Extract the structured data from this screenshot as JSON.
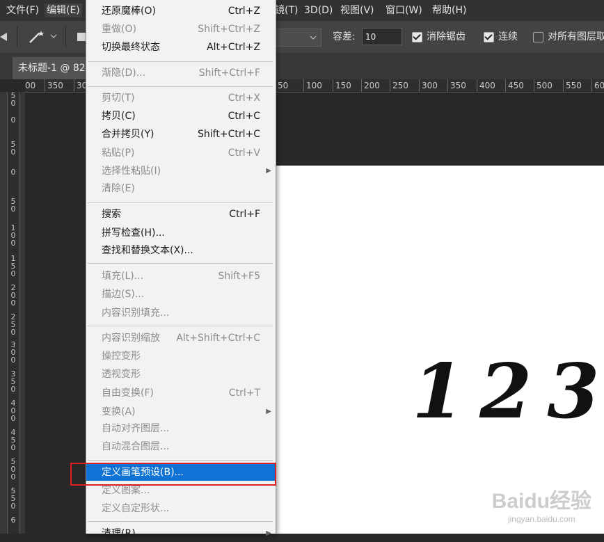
{
  "menubar": {
    "items": [
      {
        "label": "文件(F)"
      },
      {
        "label": "编辑(E)"
      },
      {
        "label": "镜(T)"
      },
      {
        "label": "3D(D)"
      },
      {
        "label": "视图(V)"
      },
      {
        "label": "窗口(W)"
      },
      {
        "label": "帮助(H)"
      }
    ]
  },
  "options": {
    "tolerance_label": "容差:",
    "tolerance_value": "10",
    "antialias_label": "消除锯齿",
    "antialias_checked": true,
    "contiguous_label": "连续",
    "contiguous_checked": true,
    "all_layers_label": "对所有图层取",
    "all_layers_checked": false
  },
  "document": {
    "tab_title": "未标题-1 @ 82",
    "glyph_text": "123"
  },
  "ruler": {
    "h_labels": [
      "00",
      "350",
      "30",
      "50",
      "100",
      "150",
      "200",
      "250",
      "300",
      "350",
      "400",
      "450",
      "500",
      "550",
      "60"
    ],
    "v_labels": [
      "5\n0",
      "0",
      "5\n0",
      "0",
      "5\n0",
      "1\n0\n0",
      "1\n5\n0",
      "2\n0\n0",
      "2\n5\n0",
      "3\n0\n0",
      "3\n5\n0",
      "4\n0\n0",
      "4\n5\n0",
      "5\n0\n0",
      "5\n5\n0",
      "6"
    ]
  },
  "edit_menu": {
    "items": [
      {
        "label": "还原魔棒(O)",
        "shortcut": "Ctrl+Z",
        "disabled": false
      },
      {
        "label": "重做(O)",
        "shortcut": "Shift+Ctrl+Z",
        "disabled": true
      },
      {
        "label": "切换最终状态",
        "shortcut": "Alt+Ctrl+Z",
        "disabled": false
      },
      {
        "label": "渐隐(D)...",
        "shortcut": "Shift+Ctrl+F",
        "disabled": true
      },
      {
        "label": "剪切(T)",
        "shortcut": "Ctrl+X",
        "disabled": true
      },
      {
        "label": "拷贝(C)",
        "shortcut": "Ctrl+C",
        "disabled": false
      },
      {
        "label": "合并拷贝(Y)",
        "shortcut": "Shift+Ctrl+C",
        "disabled": false
      },
      {
        "label": "粘贴(P)",
        "shortcut": "Ctrl+V",
        "disabled": true
      },
      {
        "label": "选择性粘贴(I)",
        "shortcut": "",
        "disabled": true,
        "submenu": true
      },
      {
        "label": "清除(E)",
        "shortcut": "",
        "disabled": true
      },
      {
        "label": "搜索",
        "shortcut": "Ctrl+F",
        "disabled": false
      },
      {
        "label": "拼写检查(H)...",
        "shortcut": "",
        "disabled": false
      },
      {
        "label": "查找和替换文本(X)...",
        "shortcut": "",
        "disabled": false
      },
      {
        "label": "填充(L)...",
        "shortcut": "Shift+F5",
        "disabled": true
      },
      {
        "label": "描边(S)...",
        "shortcut": "",
        "disabled": true
      },
      {
        "label": "内容识别填充...",
        "shortcut": "",
        "disabled": true
      },
      {
        "label": "内容识别缩放",
        "shortcut": "Alt+Shift+Ctrl+C",
        "disabled": true
      },
      {
        "label": "操控变形",
        "shortcut": "",
        "disabled": true
      },
      {
        "label": "透视变形",
        "shortcut": "",
        "disabled": true
      },
      {
        "label": "自由变换(F)",
        "shortcut": "Ctrl+T",
        "disabled": true
      },
      {
        "label": "变换(A)",
        "shortcut": "",
        "disabled": true,
        "submenu": true
      },
      {
        "label": "自动对齐图层...",
        "shortcut": "",
        "disabled": true
      },
      {
        "label": "自动混合图层...",
        "shortcut": "",
        "disabled": true
      },
      {
        "label": "定义画笔预设(B)...",
        "shortcut": "",
        "disabled": false,
        "highlighted": true
      },
      {
        "label": "定义图案...",
        "shortcut": "",
        "disabled": true
      },
      {
        "label": "定义自定形状...",
        "shortcut": "",
        "disabled": true
      },
      {
        "label": "清理(R)",
        "shortcut": "",
        "disabled": false,
        "submenu": true
      }
    ]
  },
  "watermark": {
    "logo": "Baidu经验",
    "url": "jingyan.baidu.com"
  },
  "colors": {
    "highlight": "#0f73d6",
    "annotation_box": "#e02020"
  }
}
